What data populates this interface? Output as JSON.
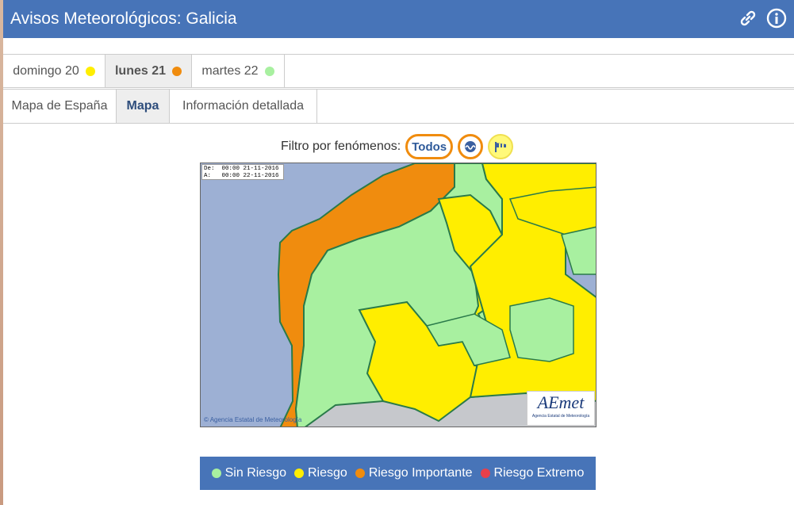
{
  "header": {
    "title": "Avisos Meteorológicos: Galicia"
  },
  "day_tabs": [
    {
      "label": "domingo 20",
      "color": "#ffee00"
    },
    {
      "label": "lunes 21",
      "color": "#f08c0e",
      "active": true
    },
    {
      "label": "martes 22",
      "color": "#a8f0a0"
    }
  ],
  "view_tabs": [
    {
      "label": "Mapa de España"
    },
    {
      "label": "Mapa",
      "active": true
    },
    {
      "label": "Información detallada"
    }
  ],
  "filter": {
    "label": "Filtro por fenómenos:",
    "all_label": "Todos"
  },
  "map": {
    "from_label": "De:  00:00 21-11-2016",
    "to_label": "A:   00:00 22-11-2016",
    "credit": "Agencia Estatal de Meteorología",
    "logo_text": "AEmet",
    "logo_sub": "Agencia Estatal de Meteorología",
    "colors": {
      "sea": "#9db0d4",
      "green": "#a8f0a0",
      "yellow": "#ffee00",
      "orange": "#f08c0e",
      "border": "#2a7a4a",
      "outside": "#c6c8cc"
    }
  },
  "legend": [
    {
      "label": "Sin Riesgo",
      "color": "#a8f0a0"
    },
    {
      "label": "Riesgo",
      "color": "#ffee00"
    },
    {
      "label": "Riesgo Importante",
      "color": "#f08c0e"
    },
    {
      "label": "Riesgo Extremo",
      "color": "#e8404a"
    }
  ]
}
